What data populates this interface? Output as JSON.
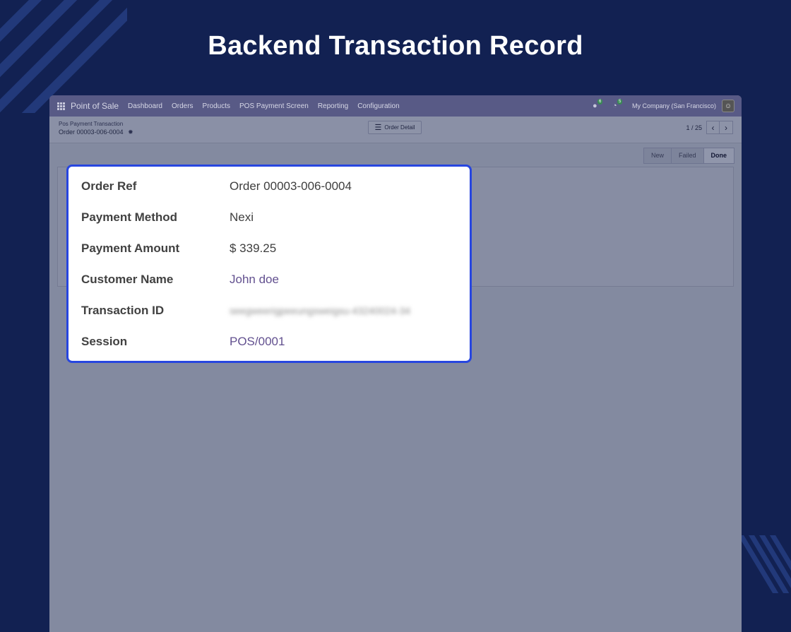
{
  "headline": "Backend Transaction Record",
  "navbar": {
    "app_name": "Point of Sale",
    "items": [
      "Dashboard",
      "Orders",
      "Products",
      "POS Payment Screen",
      "Reporting",
      "Configuration"
    ],
    "messages_badge": "6",
    "activities_badge": "5",
    "company": "My Company (San Francisco)"
  },
  "control": {
    "breadcrumb_parent": "Pos Payment Transaction",
    "record_name": "Order 00003-006-0004",
    "order_detail_label": "Order Detail",
    "pager_value": "1 / 25"
  },
  "status_stages": [
    {
      "label": "New",
      "active": false
    },
    {
      "label": "Failed",
      "active": false
    },
    {
      "label": "Done",
      "active": true
    }
  ],
  "record": {
    "order_ref_label": "Order Ref",
    "order_ref_value": "Order 00003-006-0004",
    "payment_method_label": "Payment Method",
    "payment_method_value": "Nexi",
    "payment_amount_label": "Payment Amount",
    "payment_amount_value": "$ 339.25",
    "customer_name_label": "Customer Name",
    "customer_name_value": "John doe",
    "transaction_id_label": "Transaction ID",
    "transaction_id_value": "seegweerigpeeungsweigsu-43240024-34",
    "session_label": "Session",
    "session_value": "POS/0001"
  },
  "colors": {
    "page_background": "#122152",
    "navbar": "#585a86",
    "card_border": "#2746e0",
    "link": "#62508f",
    "overlay": "#838aa0"
  },
  "icons": {
    "apps_menu": "grid-icon",
    "messages": "chat-icon",
    "activities": "clock-icon",
    "record_settings": "gear-icon",
    "order_detail": "list-icon",
    "pager_prev": "chevron-left-icon",
    "pager_next": "chevron-right-icon"
  }
}
